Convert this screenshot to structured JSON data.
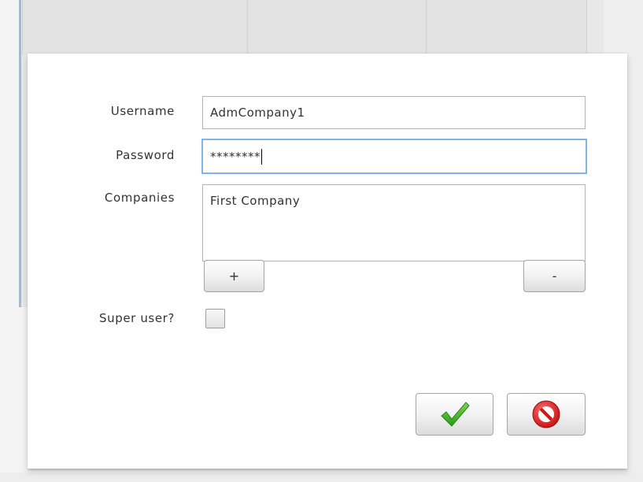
{
  "form": {
    "username_label": "Username",
    "username_value": "AdmCompany1",
    "password_label": "Password",
    "password_value": "********",
    "companies_label": "Companies",
    "companies": [
      "First Company"
    ],
    "add_company_label": "+",
    "remove_company_label": "-",
    "superuser_label": "Super user?",
    "superuser_checked": false
  },
  "actions": {
    "confirm_icon": "checkmark-icon",
    "cancel_icon": "prohibited-icon"
  },
  "colors": {
    "focus_border": "#7eb4ea",
    "confirm_green": "#3caa1e",
    "cancel_red": "#d81e1e"
  }
}
